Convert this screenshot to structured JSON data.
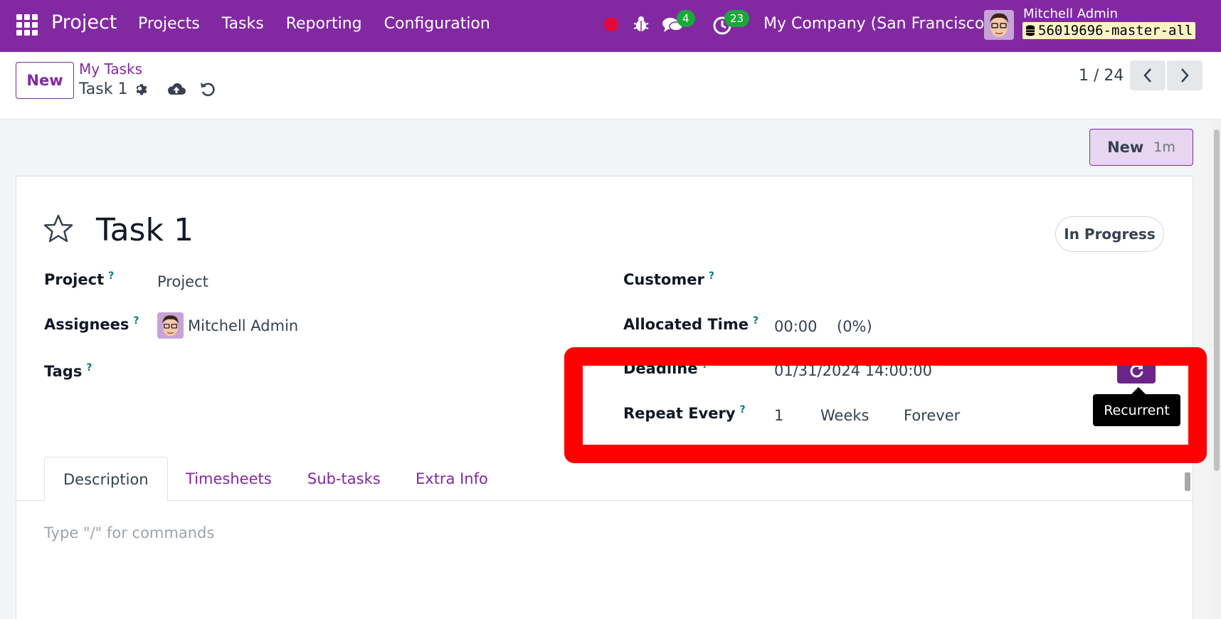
{
  "navbar": {
    "app_title": "Project",
    "menu": [
      "Projects",
      "Tasks",
      "Reporting",
      "Configuration"
    ],
    "chat_count": "4",
    "activity_count": "23",
    "company": "My Company (San Francisco)",
    "user_name": "Mitchell Admin",
    "database": "56019696-master-all"
  },
  "control": {
    "new_label": "New",
    "breadcrumb_parent": "My Tasks",
    "breadcrumb_current": "Task 1",
    "pager": "1 / 24"
  },
  "stage": {
    "label": "New",
    "duration": "1m"
  },
  "form": {
    "title": "Task 1",
    "status": "In Progress",
    "help_mark": "?",
    "project_label": "Project",
    "project_value": "Project",
    "assignees_label": "Assignees",
    "assignee_name": "Mitchell Admin",
    "tags_label": "Tags",
    "customer_label": "Customer",
    "allocated_label": "Allocated Time",
    "allocated_value": "00:00",
    "allocated_percent": "(0%)",
    "deadline_label": "Deadline",
    "deadline_value": "01/31/2024 14:00:00",
    "repeat_label": "Repeat Every",
    "repeat_interval": "1",
    "repeat_unit": "Weeks",
    "repeat_type": "Forever",
    "recurrent_tooltip": "Recurrent"
  },
  "tabs": [
    "Description",
    "Timesheets",
    "Sub-tasks",
    "Extra Info"
  ],
  "editor": {
    "placeholder": "Type \"/\" for commands"
  },
  "colors": {
    "brand": "#8229a2",
    "badge": "#19a83a",
    "highlight": "#ff0000",
    "help": "#017e84"
  }
}
